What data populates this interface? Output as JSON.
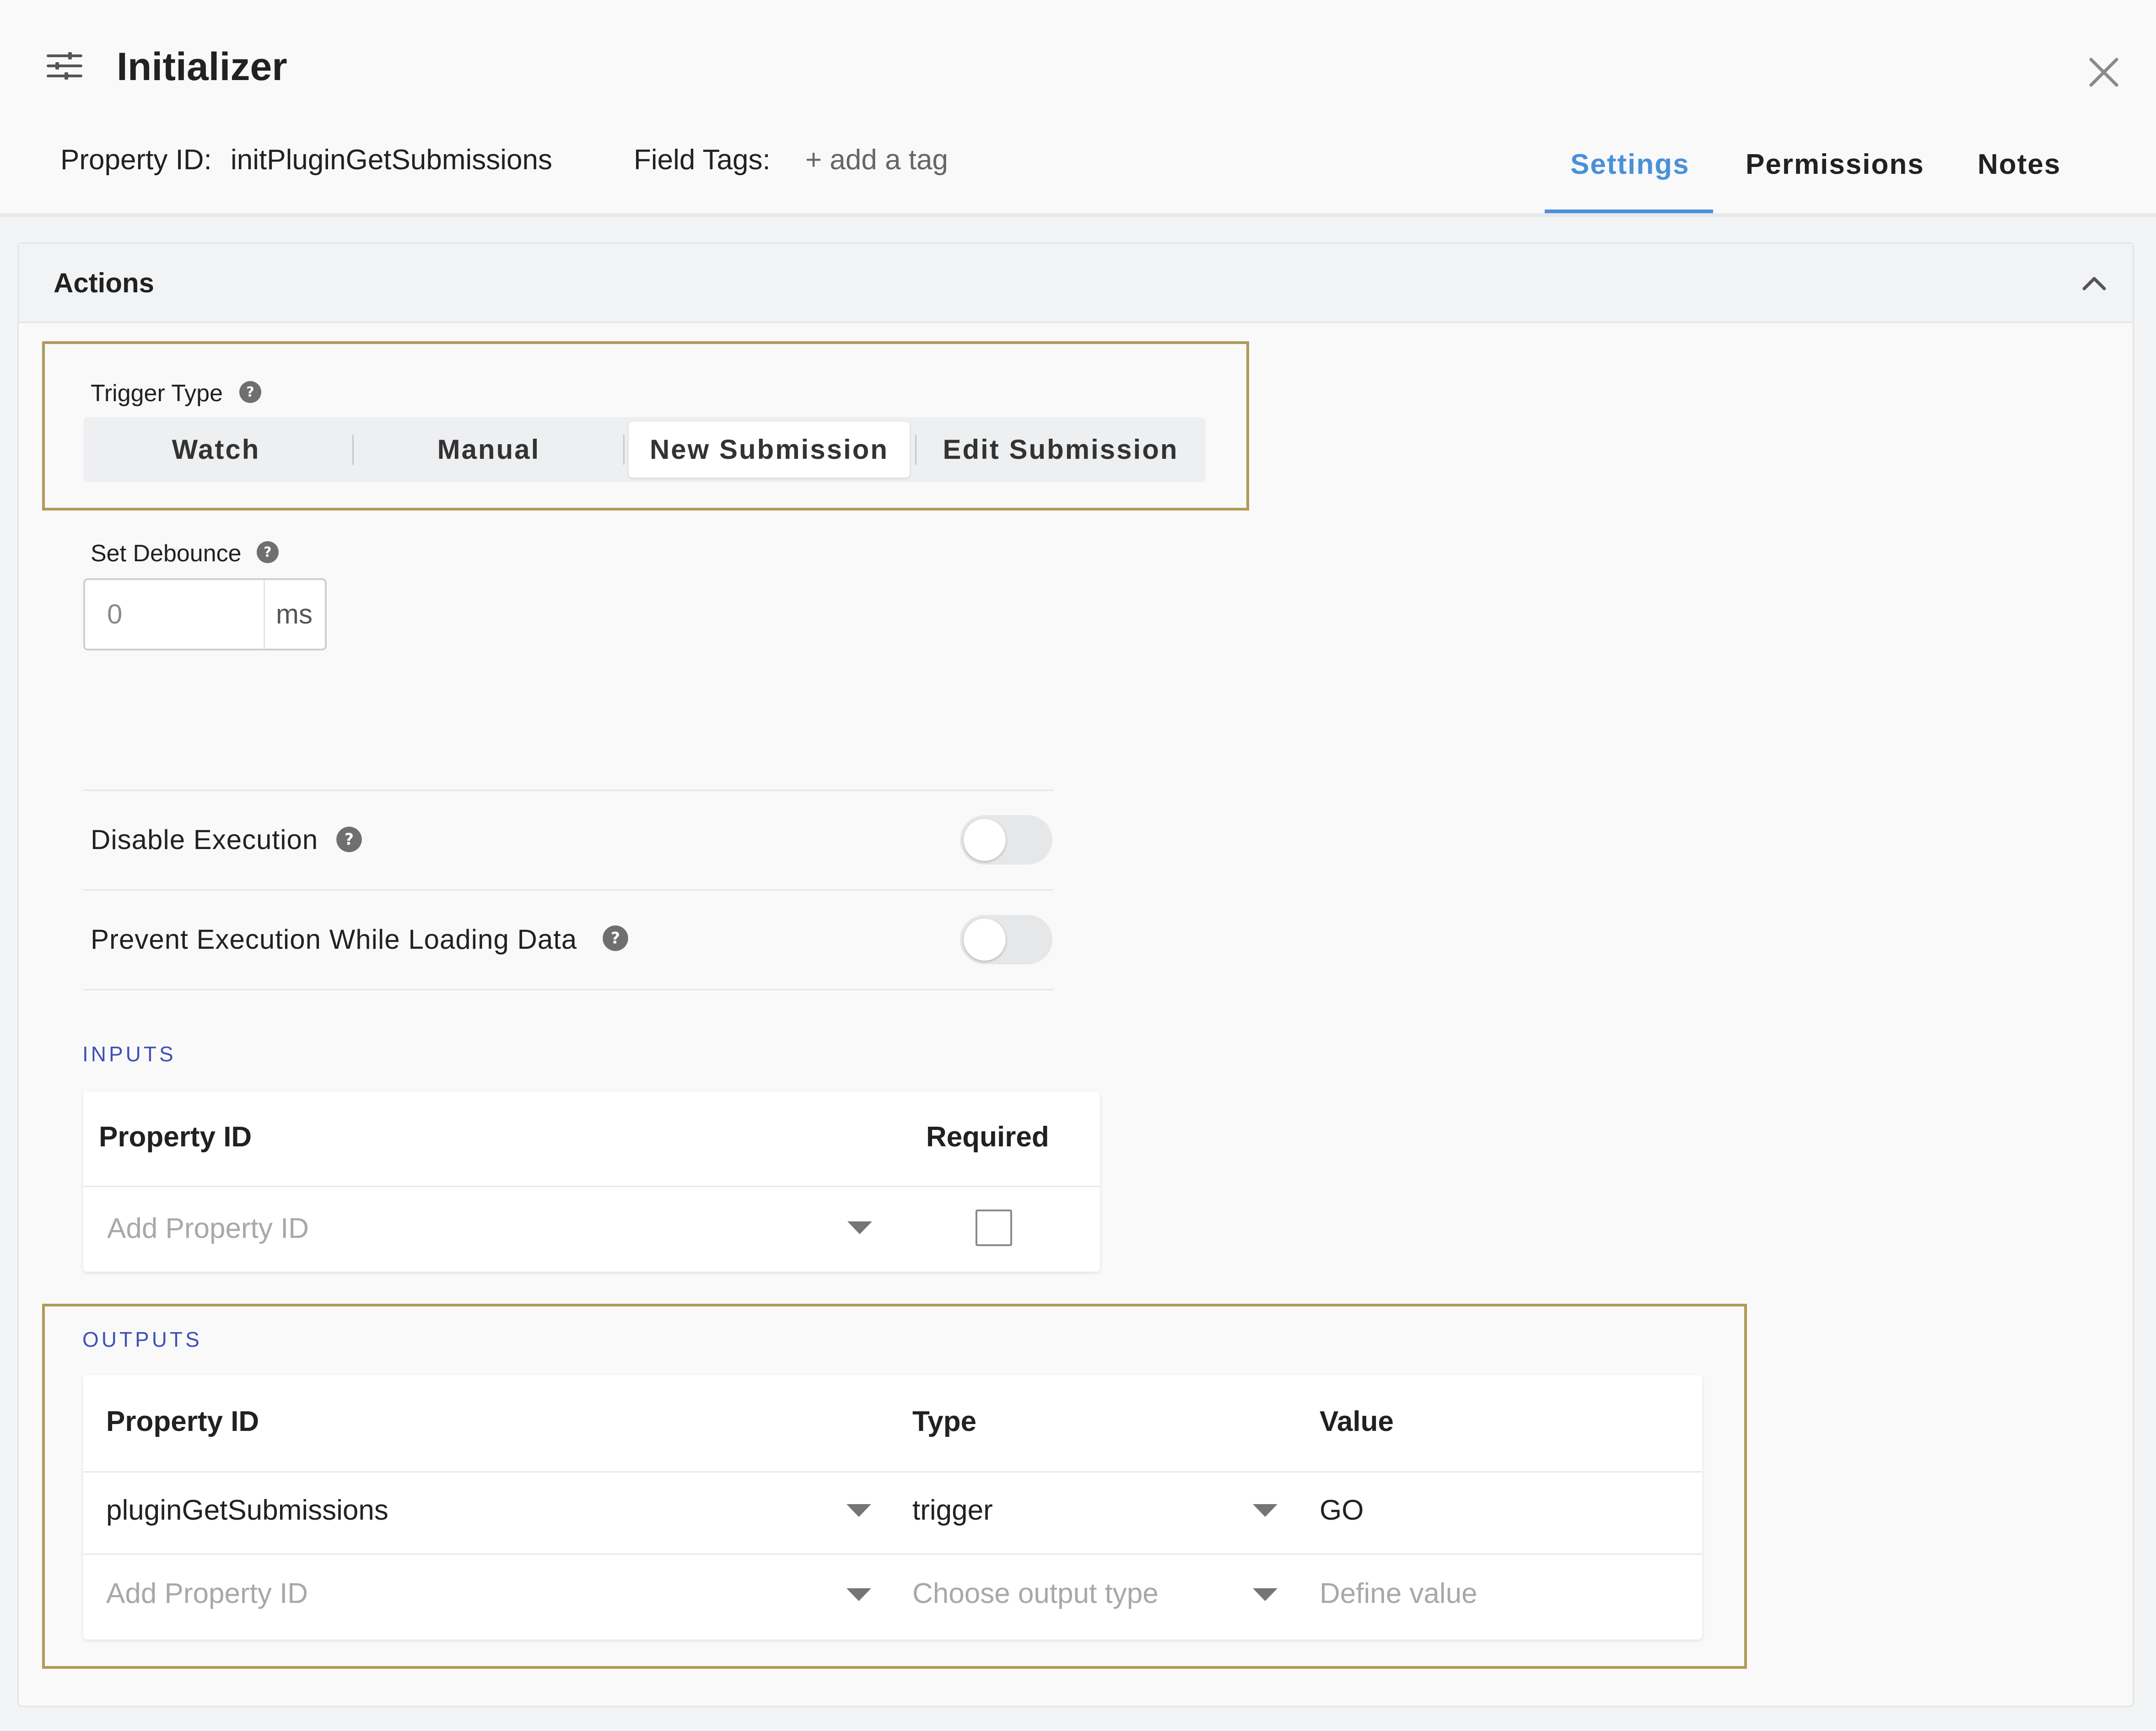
{
  "header": {
    "title": "Initializer",
    "property_id_label": "Property ID:",
    "property_id_value": "initPluginGetSubmissions",
    "field_tags_label": "Field Tags:",
    "add_tag_label": "+ add a tag",
    "tabs": [
      {
        "label": "Settings",
        "active": true
      },
      {
        "label": "Permissions",
        "active": false
      },
      {
        "label": "Notes",
        "active": false
      }
    ]
  },
  "actions": {
    "title": "Actions",
    "trigger_type": {
      "label": "Trigger Type",
      "options": [
        "Watch",
        "Manual",
        "New Submission",
        "Edit Submission"
      ],
      "selected": "New Submission"
    },
    "debounce": {
      "label": "Set Debounce",
      "value": "0",
      "unit": "ms"
    },
    "disable_execution": {
      "label": "Disable Execution",
      "on": false
    },
    "prevent_execution": {
      "label": "Prevent Execution While Loading Data",
      "on": false
    }
  },
  "inputs": {
    "heading": "INPUTS",
    "columns": [
      "Property ID",
      "Required"
    ],
    "rows": [
      {
        "property_id_placeholder": "Add Property ID",
        "required": false
      }
    ]
  },
  "outputs": {
    "heading": "OUTPUTS",
    "columns": [
      "Property ID",
      "Type",
      "Value"
    ],
    "rows": [
      {
        "property_id": "pluginGetSubmissions",
        "type": "trigger",
        "value": "GO"
      }
    ],
    "empty_row": {
      "property_id_placeholder": "Add Property ID",
      "type_placeholder": "Choose output type",
      "value_placeholder": "Define value"
    }
  },
  "colors": {
    "accent": "#4a90d9",
    "section_heading": "#3f51b5",
    "highlight_border": "#b09a58"
  }
}
